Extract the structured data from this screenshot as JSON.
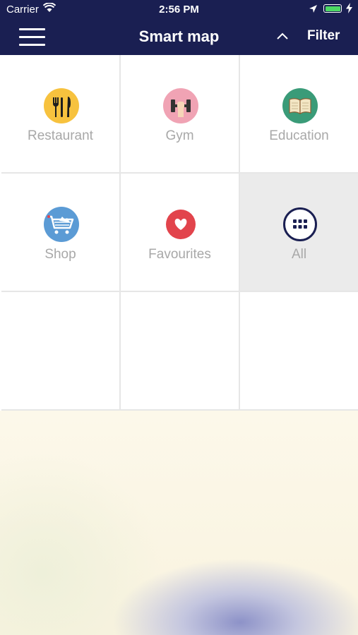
{
  "status_bar": {
    "carrier": "Carrier",
    "time": "2:56 PM",
    "battery_level": 1.0
  },
  "header": {
    "title": "Smart map",
    "filter_label": "Filter",
    "background": "#1a1f52"
  },
  "categories": [
    {
      "label": "Restaurant",
      "icon": "restaurant-icon",
      "color": "#f7c23e",
      "selected": false
    },
    {
      "label": "Gym",
      "icon": "gym-icon",
      "color": "#f0a3b4",
      "selected": false
    },
    {
      "label": "Education",
      "icon": "education-icon",
      "color": "#3a9b78",
      "selected": false
    },
    {
      "label": "Shop",
      "icon": "shop-icon",
      "color": "#5b9bd5",
      "selected": false
    },
    {
      "label": "Favourites",
      "icon": "heart-icon",
      "color": "#e2444c",
      "selected": false
    },
    {
      "label": "All",
      "icon": "grid-icon",
      "color": "#1a1f52",
      "selected": true
    }
  ]
}
